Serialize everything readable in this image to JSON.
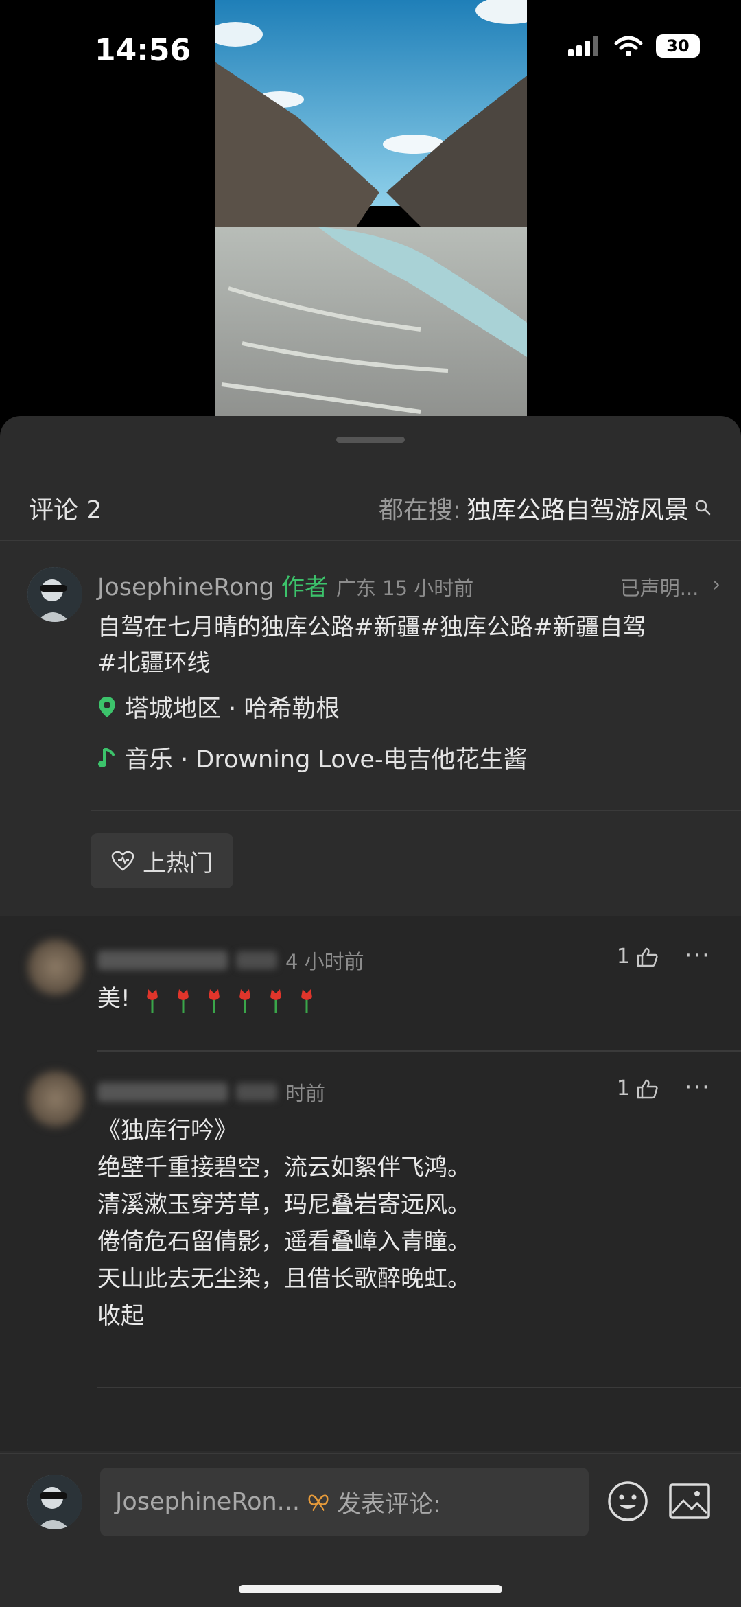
{
  "status_bar": {
    "time": "14:56",
    "battery": "30"
  },
  "header": {
    "comments_label": "评论 2",
    "search_prefix": "都在搜:",
    "search_query": "独库公路自驾游风景"
  },
  "post": {
    "author": "JosephineRong",
    "author_tag": "作者",
    "meta": "广东 15 小时前",
    "declared": "已声明...",
    "text_line1": "自驾在七月晴的独库公路#新疆#独库公路#新疆自驾",
    "text_line2": "#北疆环线",
    "location": "塔城地区 · 哈希勒根",
    "music": "音乐 · Drowning Love-电吉他花生酱",
    "hot_button": "上热门"
  },
  "comments": [
    {
      "time": "4 小时前",
      "likes": "1",
      "text": "美!"
    },
    {
      "time": "时前",
      "likes": "1",
      "lines": [
        "《独库行吟》",
        "绝壁千重接碧空，流云如絮伴飞鸿。",
        "清溪漱玉穿芳草，玛尼叠岩寄远风。",
        "倦倚危石留倩影，遥看叠嶂入青瞳。",
        "天山此去无尘染，且借长歌醉晚虹。"
      ],
      "collapse": "收起"
    }
  ],
  "compose": {
    "user": "JosephineRon...",
    "placeholder": "发表评论:"
  },
  "colors": {
    "accent_green": "#3cc36b",
    "sheet_bg": "#2c2c2c"
  },
  "icons": [
    "location-pin-icon",
    "music-note-icon",
    "heart-icon",
    "thumbs-up-icon",
    "more-icon",
    "search-icon",
    "emoji-icon",
    "image-icon",
    "chevron-right-icon",
    "butterfly-badge-icon"
  ]
}
